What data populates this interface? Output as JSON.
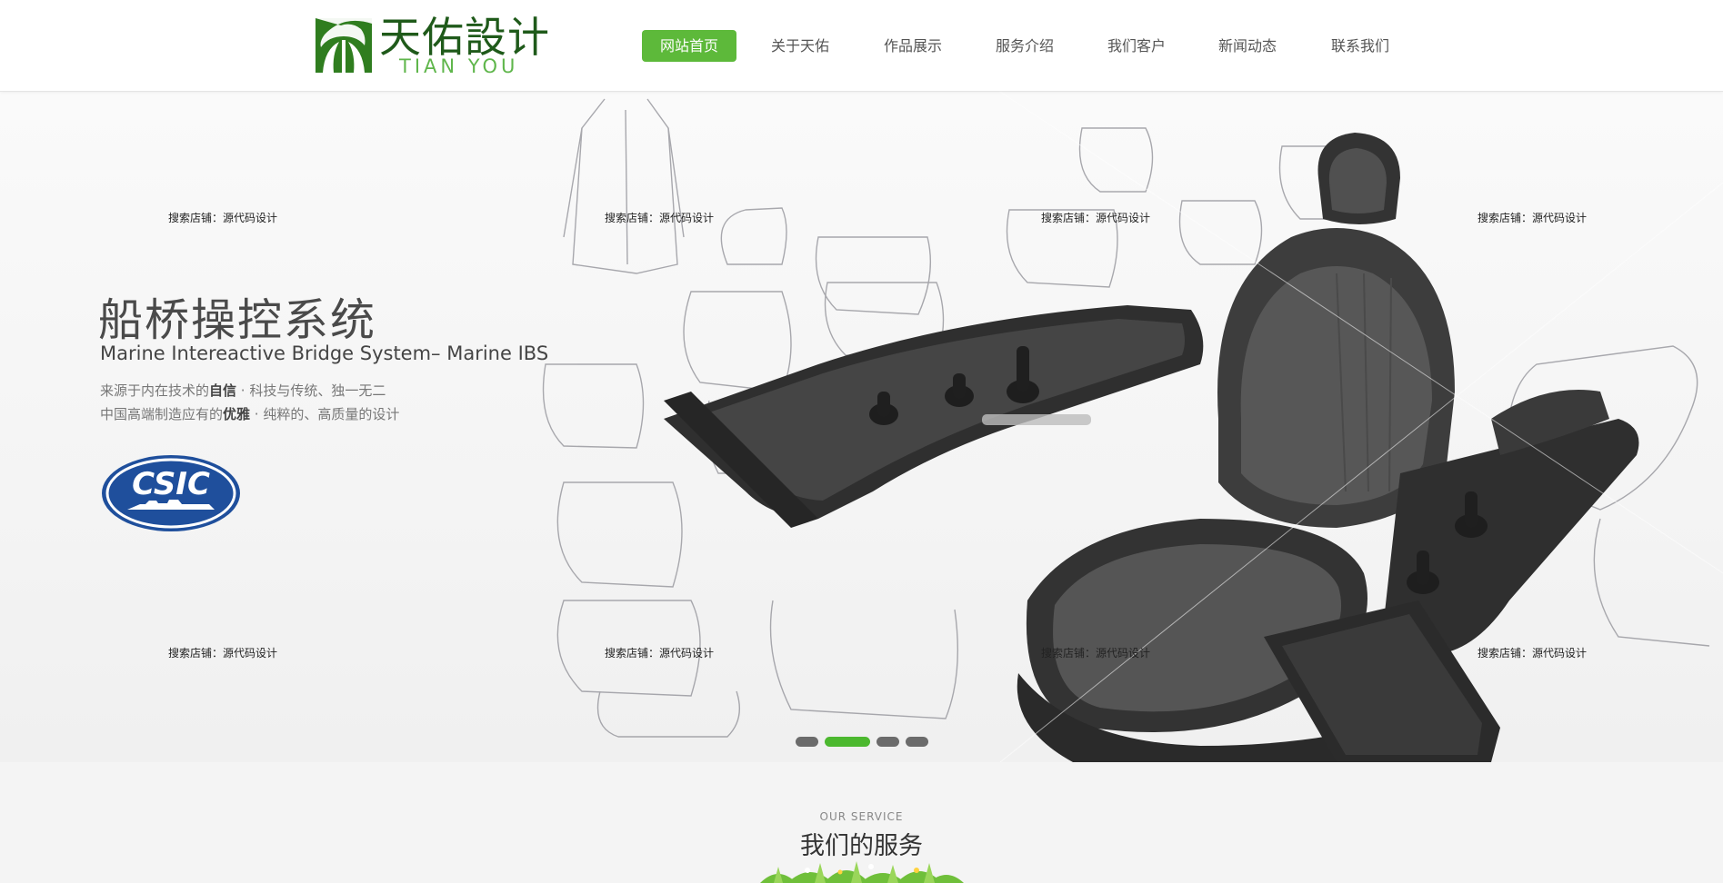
{
  "header": {
    "logo": {
      "cn": "天佑設计",
      "en": "TIAN YOU"
    },
    "nav": [
      {
        "label": "网站首页",
        "active": true
      },
      {
        "label": "关于天佑",
        "active": false
      },
      {
        "label": "作品展示",
        "active": false
      },
      {
        "label": "服务介绍",
        "active": false
      },
      {
        "label": "我们客户",
        "active": false
      },
      {
        "label": "新闻动态",
        "active": false
      },
      {
        "label": "联系我们",
        "active": false
      }
    ]
  },
  "banner": {
    "title": "船桥操控系统",
    "subtitle": "Marine Intereactive Bridge System– Marine IBS",
    "line1_a": "来源于内在技术的",
    "line1_b": "自信",
    "line1_c": "   · 科技与传统、独一无二",
    "line2_a": "中国高端制造应有的",
    "line2_b": "优雅",
    "line2_c": " · 纯粹的、高质量的设计",
    "client_logo": "CSIC",
    "watermark": "搜索店铺：源代码设计",
    "slide_count": 4,
    "active_slide": 2
  },
  "service": {
    "en": "OUR SERVICE",
    "cn": "我们的服务"
  },
  "colors": {
    "accent_green": "#5db93a",
    "logo_dark_green": "#1f5a1a",
    "logo_light_green": "#5fb64b",
    "csic_blue": "#1f4f9c"
  }
}
